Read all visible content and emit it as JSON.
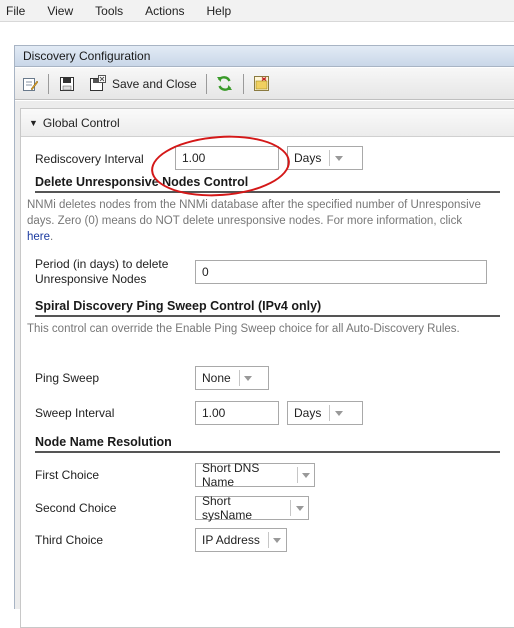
{
  "menubar": {
    "items": [
      "File",
      "View",
      "Tools",
      "Actions",
      "Help"
    ]
  },
  "window": {
    "title": "Discovery Configuration"
  },
  "toolbar": {
    "save_close_label": "Save and Close"
  },
  "global_control": {
    "header": "Global Control",
    "rediscovery_label": "Rediscovery Interval",
    "rediscovery_value": "1.00",
    "rediscovery_unit": "Days"
  },
  "delete_unresponsive": {
    "title": "Delete Unresponsive Nodes Control",
    "desc_prefix": "NNMi deletes nodes from the NNMi database after the specified number of Unresponsive days. Zero (0) means do NOT delete unresponsive nodes. For more information, click ",
    "desc_link": "here",
    "desc_suffix": ".",
    "period_label": "Period (in days) to delete Unresponsive Nodes",
    "period_value": "0"
  },
  "ping_sweep": {
    "title": "Spiral Discovery Ping Sweep Control (IPv4 only)",
    "desc": "This control can override the Enable Ping Sweep choice for all Auto-Discovery Rules.",
    "ping_sweep_label": "Ping Sweep",
    "ping_sweep_value": "None",
    "sweep_interval_label": "Sweep Interval",
    "sweep_interval_value": "1.00",
    "sweep_interval_unit": "Days"
  },
  "name_resolution": {
    "title": "Node Name Resolution",
    "first_label": "First Choice",
    "first_value": "Short DNS Name",
    "second_label": "Second Choice",
    "second_value": "Short sysName",
    "third_label": "Third Choice",
    "third_value": "IP Address"
  },
  "colors": {
    "annotation": "#d41818",
    "refresh_icon": "#3a9a2a",
    "link": "#1a3aa0"
  }
}
